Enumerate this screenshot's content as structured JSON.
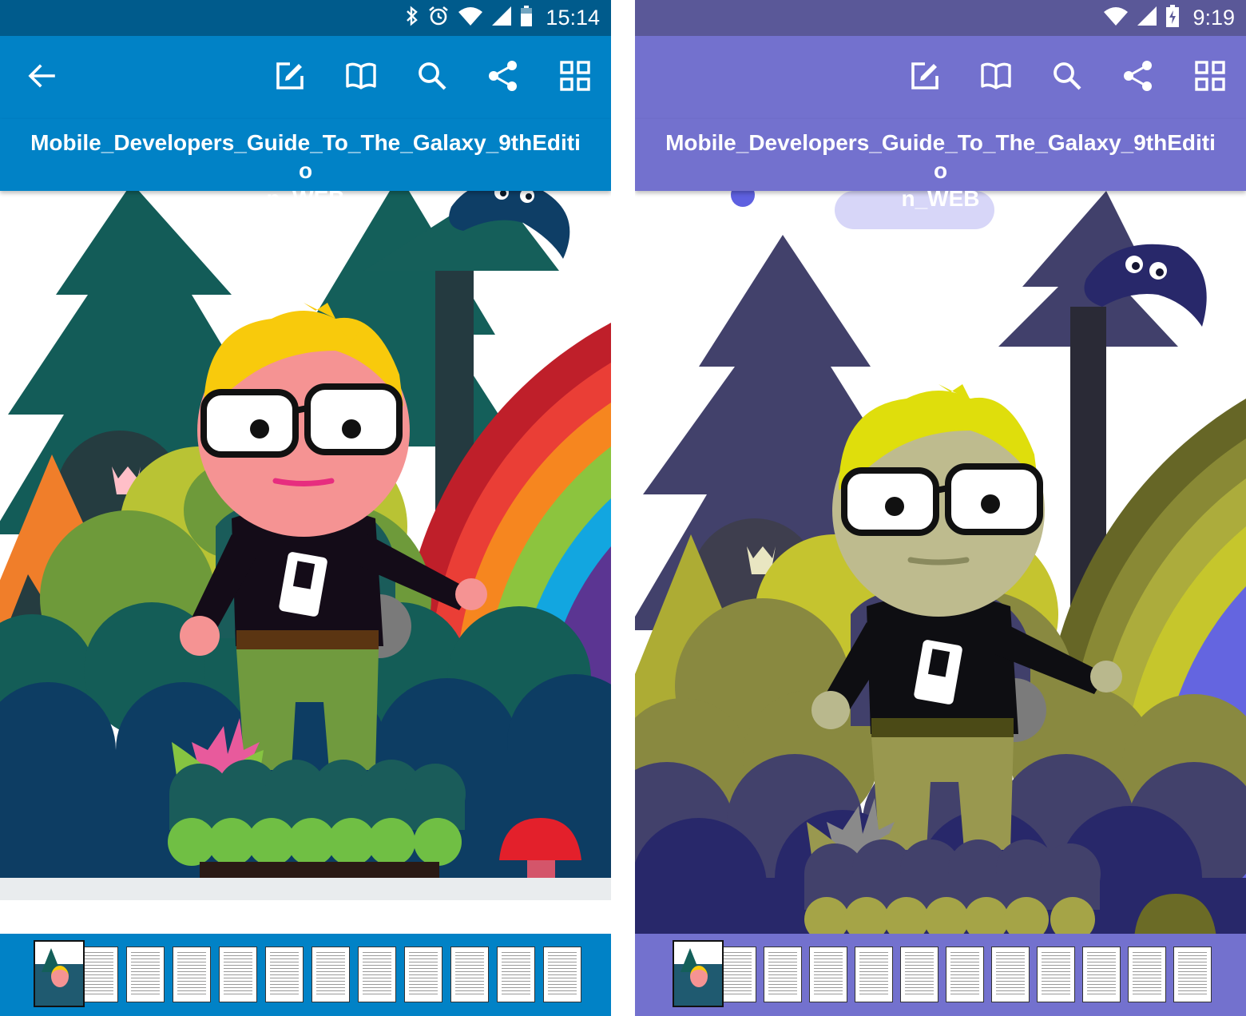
{
  "document_title": "Mobile_Developers_Guide_To_The_Galaxy_9thEdition_WEB",
  "colors": {
    "left_status": "#005b8c",
    "left_primary": "#0182c6",
    "right_status": "#5a5898",
    "right_primary": "#7371ce"
  },
  "left": {
    "status": {
      "time": "15:14",
      "icons": [
        "bluetooth-icon",
        "alarm-icon",
        "wifi-icon",
        "cell-signal-icon",
        "battery-icon"
      ]
    },
    "toolbar": {
      "icons": [
        "back-arrow-icon",
        "edit-icon",
        "book-icon",
        "search-icon",
        "share-icon",
        "grid-icon"
      ]
    },
    "title_line1": "Mobile_Developers_Guide_To_The_Galaxy_9thEditio",
    "title_line2": "n_WEB",
    "thumbnails_count": 12,
    "current_page": 1
  },
  "right": {
    "status": {
      "time": "9:19",
      "icons": [
        "wifi-icon",
        "cell-signal-icon",
        "battery-charging-icon"
      ]
    },
    "toolbar": {
      "icons": [
        "edit-icon",
        "book-icon",
        "search-icon",
        "share-icon",
        "grid-icon"
      ]
    },
    "title_line1": "Mobile_Developers_Guide_To_The_Galaxy_9thEditio",
    "title_line2": "n_WEB",
    "thumbnails_count": 12,
    "current_page": 1
  }
}
